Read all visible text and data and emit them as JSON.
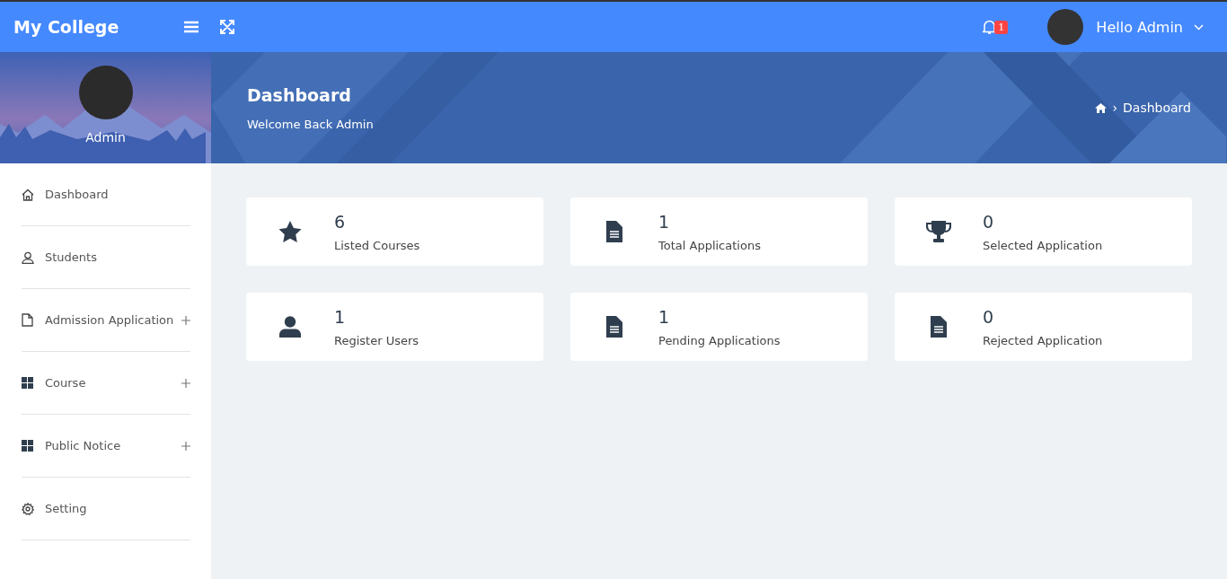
{
  "topbar": {
    "brand": "My College",
    "notifications": "1",
    "user_greeting": "Hello Admin"
  },
  "profile": {
    "name": "Admin"
  },
  "banner": {
    "title": "Dashboard",
    "subtitle": "Welcome Back Admin",
    "breadcrumb_separator": "›",
    "breadcrumb": "Dashboard"
  },
  "sidebar": {
    "items": [
      {
        "label": "Dashboard",
        "kind": "home",
        "expandable": false
      },
      {
        "label": "Students",
        "kind": "user",
        "expandable": false
      },
      {
        "label": "Admission Application",
        "kind": "file",
        "expandable": true
      },
      {
        "label": "Course",
        "kind": "grid",
        "expandable": true
      },
      {
        "label": "Public Notice",
        "kind": "grid",
        "expandable": true
      },
      {
        "label": "Setting",
        "kind": "gear",
        "expandable": false
      }
    ]
  },
  "stats": [
    {
      "value": "6",
      "label": "Listed Courses",
      "kind": "star"
    },
    {
      "value": "1",
      "label": "Total Applications",
      "kind": "file"
    },
    {
      "value": "0",
      "label": "Selected Application",
      "kind": "trophy"
    },
    {
      "value": "1",
      "label": "Register Users",
      "kind": "user"
    },
    {
      "value": "1",
      "label": "Pending Applications",
      "kind": "file"
    },
    {
      "value": "0",
      "label": "Rejected Application",
      "kind": "file"
    }
  ]
}
